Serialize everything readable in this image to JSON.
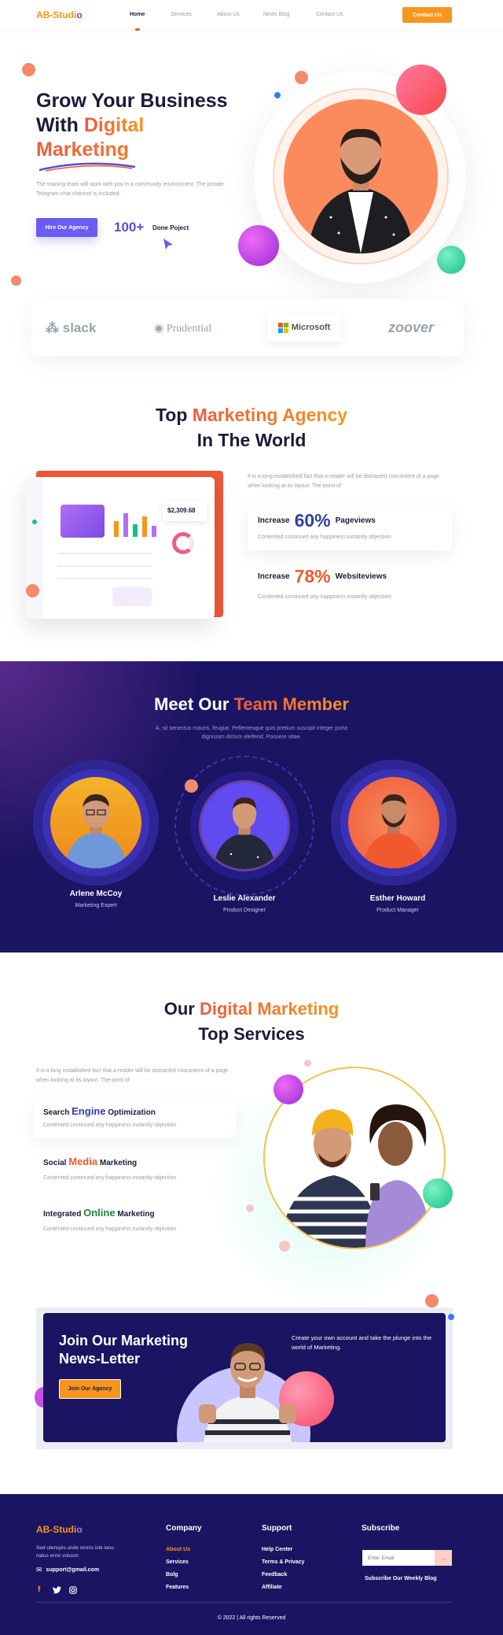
{
  "nav": {
    "logo_main": "AB-Studi",
    "logo_tail": "o",
    "items": [
      "Home",
      "Services",
      "About Us",
      "News Blog",
      "Contact Us"
    ],
    "cta": "Contact Us"
  },
  "hero": {
    "title_line1": "Grow Your Business",
    "title_line2_a": "With ",
    "title_line2_b": "Digital",
    "title_line3": "Marketing",
    "description": "The training team will work with you in a community environment. The private Telegram chat channel is included.",
    "button": "Hire Our Agency",
    "stat_value": "100+",
    "stat_label": "Done Poject"
  },
  "brands": [
    "slack",
    "Prudential",
    "Microsoft",
    "zoover"
  ],
  "agency": {
    "title_a": "Top ",
    "title_b": "Marketing Agency",
    "title_line2": "In The World",
    "intro": "It is a long established fact that a reader will be distracted  roocontent of a page when looking at its layout. The point of",
    "dashboard_amount": "$2,309.68",
    "stats": [
      {
        "prefix": "Increase",
        "value": "60%",
        "suffix": "Pageviews",
        "desc": "Contented continued any happiness instantly objection"
      },
      {
        "prefix": "Increase",
        "value": "78%",
        "suffix": "Websiteviews",
        "desc": "Contented continued any happiness instantly objection"
      }
    ],
    "colors": {
      "blue": "#2f3fa8",
      "orange": "#f15a29"
    }
  },
  "team": {
    "title_a": "Meet Our ",
    "title_b": "Team Member",
    "description": "A, sit senectus mauris, feugiat. Pellentesque quis pretium suscipit integer porta dignissim dictum eleifend. Posuere vitae.",
    "members": [
      {
        "name": "Arlene McCoy",
        "role": "Marketing Expert"
      },
      {
        "name": "Leslie Alexander",
        "role": "Product Designer"
      },
      {
        "name": "Esther Howard",
        "role": "Product Manager"
      }
    ]
  },
  "services": {
    "title_a": "Our ",
    "title_b": "Digital Marketing",
    "title_line2": "Top Services",
    "intro": "It is a long established fact that a reader will be distracted  roocontent of a page when looking at its layout. The point of",
    "items": [
      {
        "before": "Search ",
        "accent": "Engine",
        "after": " Optimization",
        "desc": "Contented continued any happiness instantly objection",
        "color": "#2f3fa8"
      },
      {
        "before": "Social ",
        "accent": "Media",
        "after": " Marketing",
        "desc": "Contented continued any happiness instantly objection",
        "color": "#f15a29"
      },
      {
        "before": "Integrated ",
        "accent": "Online",
        "after": " Marketing",
        "desc": "Contented continued any happiness instantly objection",
        "color": "#1e8a3c"
      }
    ]
  },
  "newsletter": {
    "title_line1": "Join Our Marketing",
    "title_line2": "News-Letter",
    "button": "Join Our Agency",
    "text": "Create your own  account and take the plunge into the world of Marketing."
  },
  "footer": {
    "logo_main": "AB-Studi",
    "logo_tail": "o",
    "about": "Sed utenspis unde omnis iste  lano natus error volusm",
    "email": "support@gmail.com",
    "company_title": "Company",
    "company_links": [
      "About Us",
      "Services",
      "Bolg",
      "Features"
    ],
    "support_title": "Support",
    "support_links": [
      "Help Center",
      "Terms & Privacy",
      "Feedback",
      "Affiliate"
    ],
    "subscribe_title": "Subscribe",
    "email_placeholder": "Enter Email",
    "subscribe_caption": "Subscribe Our Weekly Blog",
    "copyright": "© 2022  | All rights Reserved"
  }
}
